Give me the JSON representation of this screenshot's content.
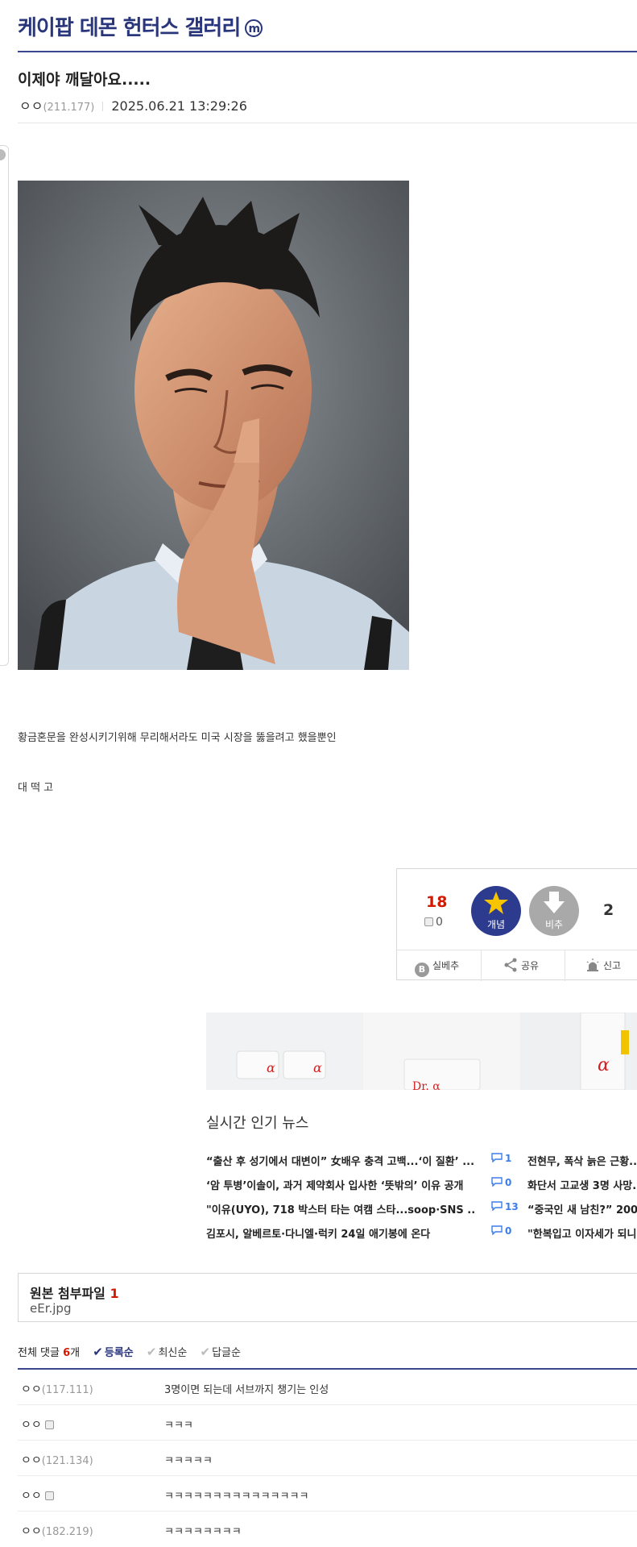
{
  "gallery": {
    "title": "케이팝 데몬 헌터스 갤러리",
    "badge": "m"
  },
  "post": {
    "title": "이제야 깨달아요.....",
    "author": "ㅇㅇ",
    "ip": "(211.177)",
    "datetime": "2025.06.21 13:29:26",
    "body_lines": [
      "황금혼문을 완성시키기위해 무리해서라도 미국 시장을 뚫을려고 했을뿐인",
      "대 떡 고"
    ]
  },
  "recommend": {
    "count": "18",
    "fixed_count": "0",
    "up_label": "개념",
    "down_label": "비추",
    "nonrec_count": "2",
    "actions": [
      "실베추",
      "공유",
      "신고"
    ]
  },
  "news": {
    "heading": "실시간 인기 뉴스",
    "items": [
      {
        "title": "“출산 후 성기에서 대변이” 女배우 충격 고백...‘이 질환’ ...",
        "comments": "1",
        "right": "전현무, 폭삭 늙은 근황..."
      },
      {
        "title": "‘암 투병’이솔이, 과거 제약회사 입사한 ‘뜻밖의’ 이유 공개",
        "comments": "0",
        "right": "화단서 고교생 3명 사망..."
      },
      {
        "title": "\"이유(UYO), 718 박스터 타는 여캠 스타...soop·SNS ...",
        "comments": "13",
        "right": "“중국인 새 남친?” 200..."
      },
      {
        "title": "김포시, 알베르토·다니엘·럭키 24일 애기봉에 온다",
        "comments": "0",
        "right": "\"한복입고 이자세가 되니..."
      }
    ]
  },
  "attachments": {
    "title": "원본 첨부파일",
    "count": "1",
    "files": [
      "eEr.jpg"
    ]
  },
  "comments": {
    "label": "전체 댓글",
    "count": "6",
    "unit": "개",
    "sorts": [
      "등록순",
      "최신순",
      "답글순"
    ],
    "rows": [
      {
        "nick": "ㅇㅇ",
        "ip": "(117.111)",
        "fixed": false,
        "text": "3명이면 되는데 서브까지 챙기는 인성"
      },
      {
        "nick": "ㅇㅇ",
        "ip": "",
        "fixed": true,
        "text": "ㅋㅋㅋ"
      },
      {
        "nick": "ㅇㅇ",
        "ip": "(121.134)",
        "fixed": false,
        "text": "ㅋㅋㅋㅋㅋ"
      },
      {
        "nick": "ㅇㅇ",
        "ip": "",
        "fixed": true,
        "text": "ㅋㅋㅋㅋㅋㅋㅋㅋㅋㅋㅋㅋㅋㅋㅋ"
      },
      {
        "nick": "ㅇㅇ",
        "ip": "(182.219)",
        "fixed": false,
        "text": "ㅋㅋㅋㅋㅋㅋㅋㅋ"
      }
    ]
  },
  "ad": {
    "brand": "Dr. α"
  },
  "colors": {
    "brand": "#29367c",
    "accent_red": "#d31900",
    "up_button": "#2d3b8f",
    "down_button": "#a9a9a9",
    "comment_blue": "#3b7de9"
  },
  "icons": [
    "star-icon",
    "down-arrow-icon",
    "fixed-nick-icon",
    "blogger-icon",
    "share-icon",
    "siren-icon",
    "comment-bubble-icon",
    "check-icon"
  ]
}
